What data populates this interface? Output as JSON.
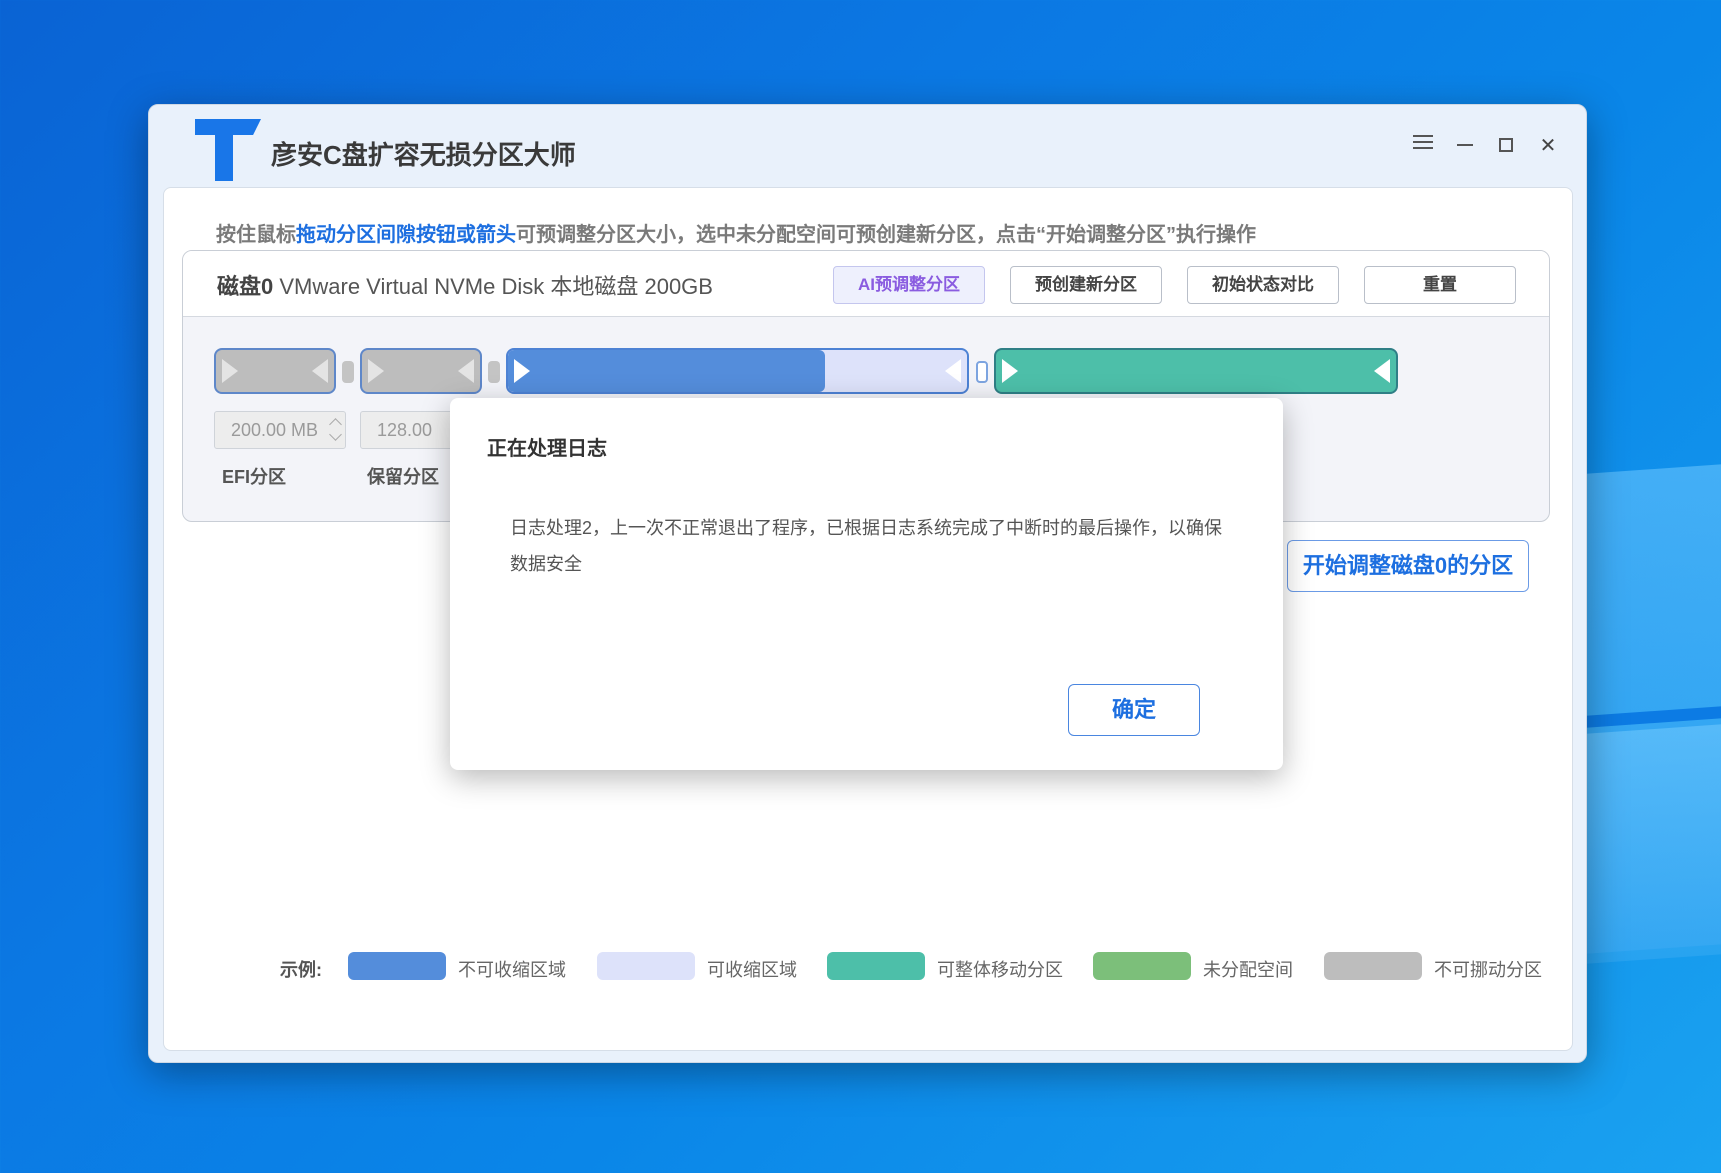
{
  "app": {
    "title": "彦安C盘扩容无损分区大师",
    "accent": "#1976e8"
  },
  "hint": {
    "prefix": "按住鼠标",
    "highlight": "拖动分区间隙按钮或箭头",
    "suffix": "可预调整分区大小，选中未分配空间可预创建新分区，点击“开始调整分区”执行操作"
  },
  "disk": {
    "name": "磁盘0",
    "description": "VMware Virtual NVMe Disk 本地磁盘 200GB",
    "buttons": {
      "ai": "AI预调整分区",
      "create": "预创建新分区",
      "compare": "初始状态对比",
      "reset": "重置"
    },
    "partitions": [
      {
        "size": "200.00 MB",
        "label": "EFI分区",
        "type": "fixed"
      },
      {
        "size": "128.00",
        "label": "保留分区",
        "type": "fixed"
      },
      {
        "type": "shrinkable",
        "used_fraction": 0.69
      },
      {
        "type": "movable"
      }
    ]
  },
  "start_button": "开始调整磁盘0的分区",
  "legend": {
    "title": "示例:",
    "items": [
      {
        "label": "不可收缩区域",
        "color": "#548ddb"
      },
      {
        "label": "可收缩区域",
        "color": "#dde2fa"
      },
      {
        "label": "可整体移动分区",
        "color": "#4dbfa9"
      },
      {
        "label": "未分配空间",
        "color": "#7cbf7a"
      },
      {
        "label": "不可挪动分区",
        "color": "#bdbdbd"
      }
    ]
  },
  "dialog": {
    "title": "正在处理日志",
    "message": "日志处理2，上一次不正常退出了程序，已根据日志系统完成了中断时的最后操作，以确保数据安全",
    "ok": "确定"
  }
}
